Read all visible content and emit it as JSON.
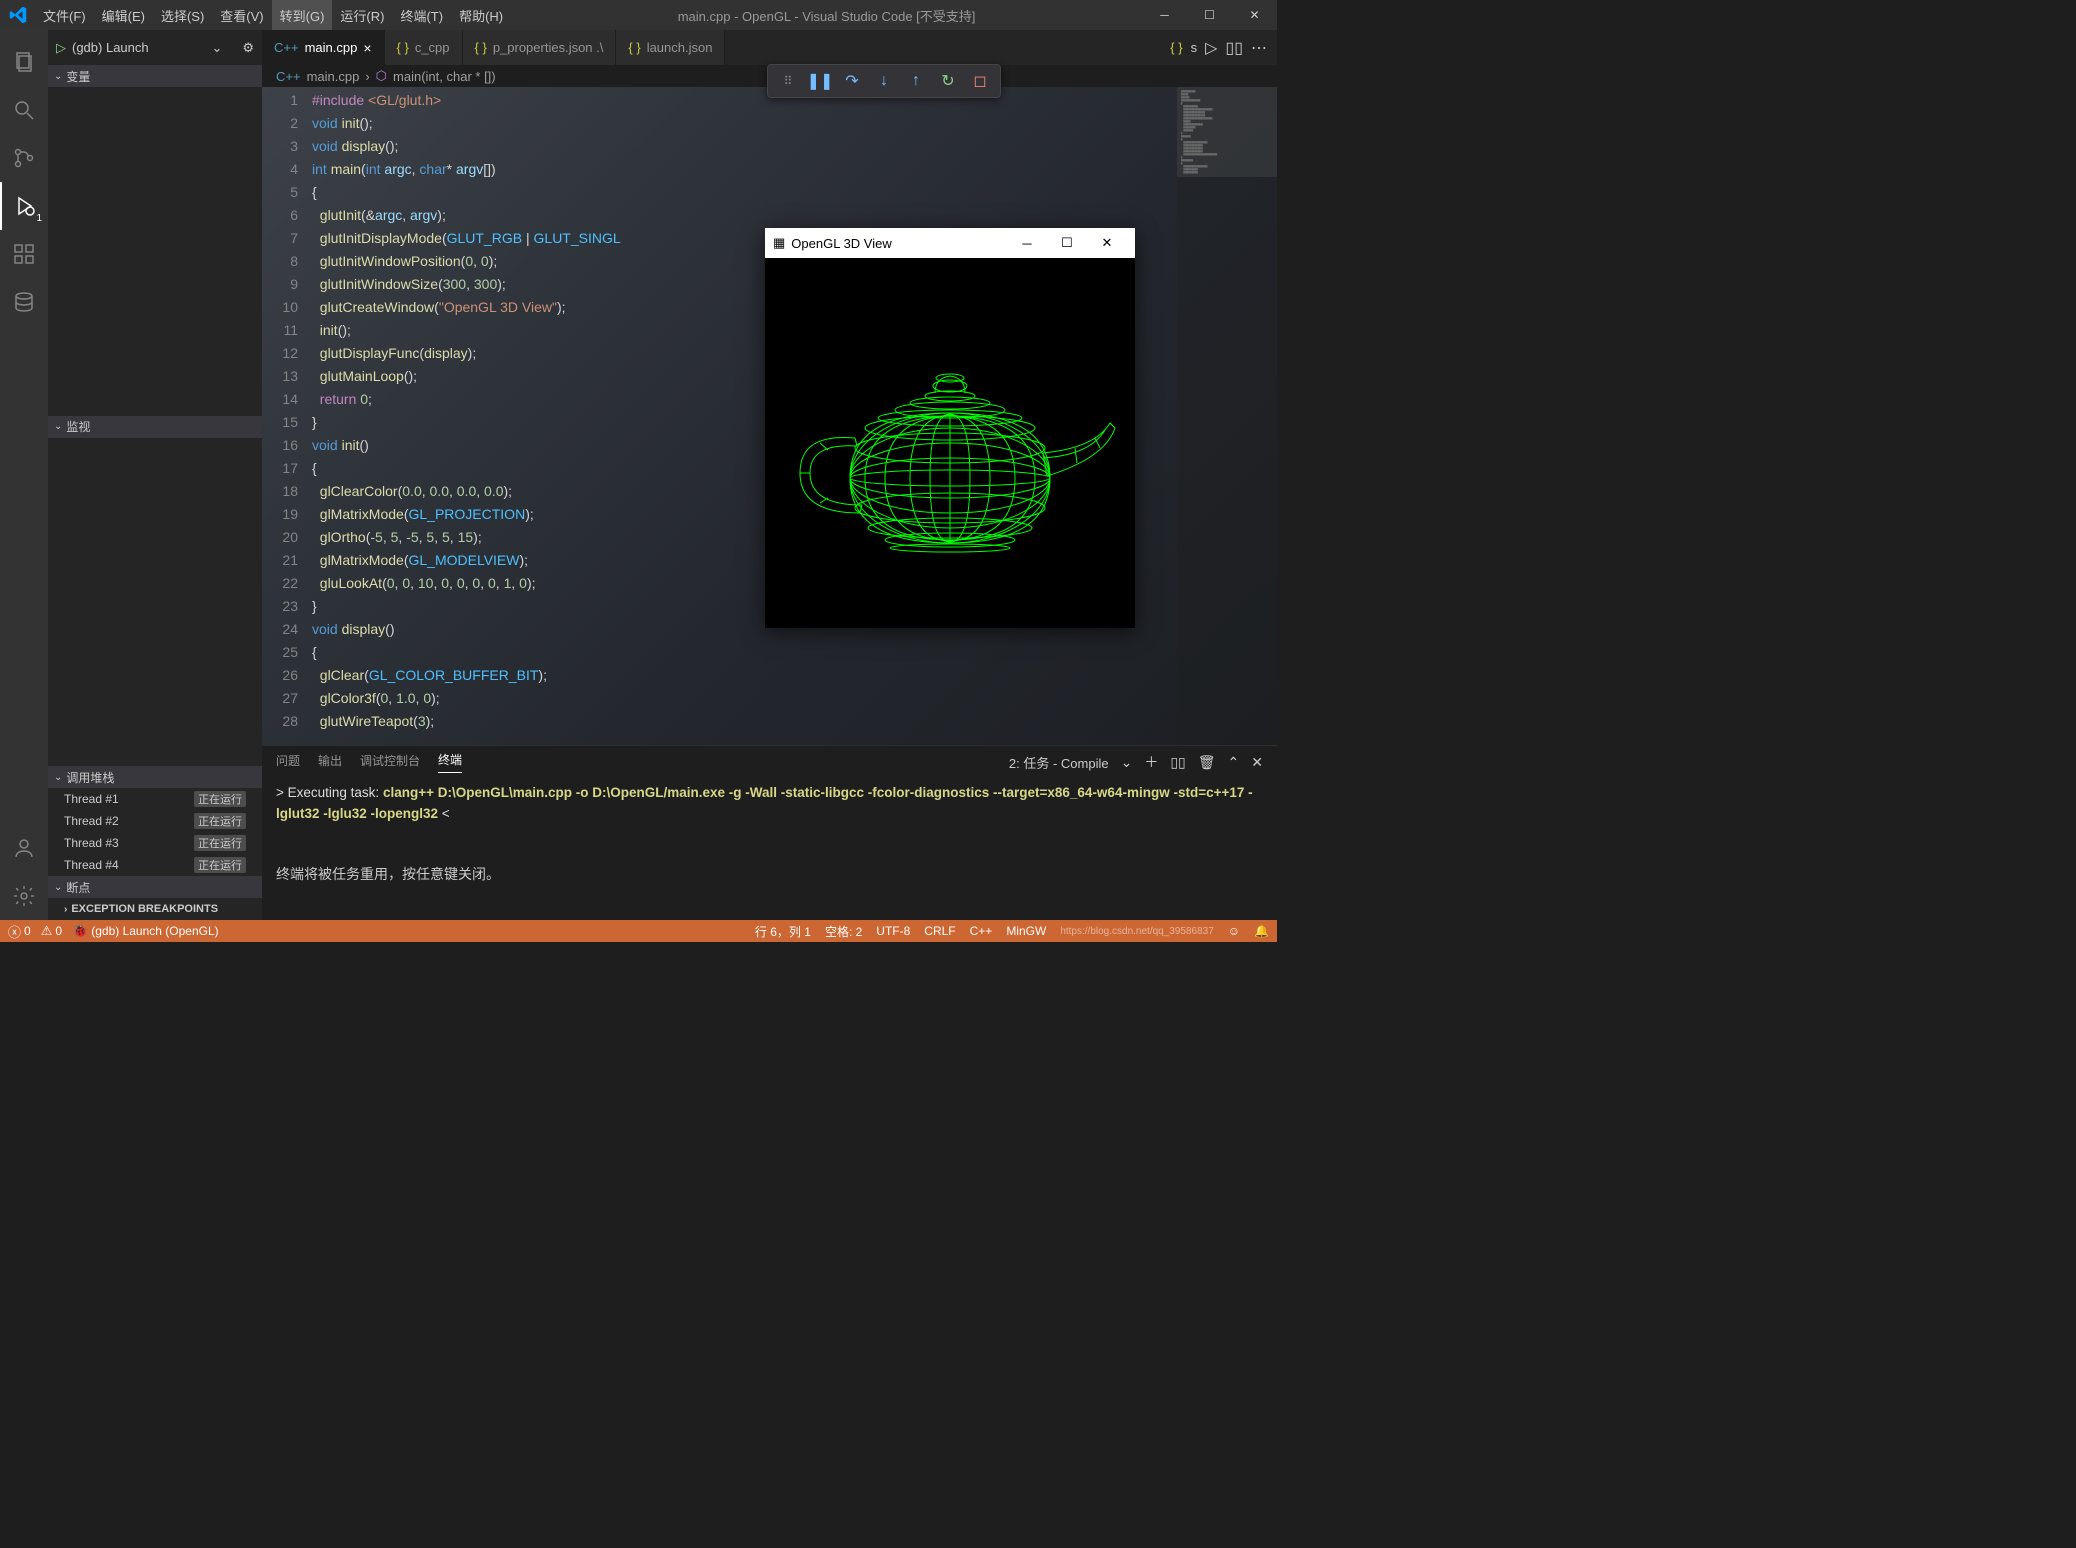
{
  "titlebar": {
    "menus": [
      "文件(F)",
      "编辑(E)",
      "选择(S)",
      "查看(V)",
      "转到(G)",
      "运行(R)",
      "终端(T)",
      "帮助(H)"
    ],
    "active_menu_index": 4,
    "title": "main.cpp - OpenGL - Visual Studio Code [不受支持]"
  },
  "activity": {
    "icons": [
      "files",
      "search",
      "source-control",
      "run-debug",
      "extensions",
      "database"
    ],
    "active_index": 3,
    "debug_badge": "1"
  },
  "sidebar": {
    "launch_label": "(gdb) Launch",
    "sections": {
      "variables": "变量",
      "watch": "监视",
      "callstack": "调用堆栈",
      "breakpoints": "断点",
      "exception_bp": "EXCEPTION BREAKPOINTS"
    },
    "running_tag": "正在运行",
    "threads": [
      "Thread #1",
      "Thread #2",
      "Thread #3",
      "Thread #4"
    ]
  },
  "tabs": [
    {
      "icon": "cpp",
      "label": "main.cpp",
      "active": true,
      "close": true
    },
    {
      "icon": "json",
      "label": "c_cpp",
      "active": false
    },
    {
      "icon": "json",
      "label": "p_properties.json .\\",
      "active": false
    },
    {
      "icon": "json",
      "label": "launch.json",
      "active": false
    }
  ],
  "tabs_right_s_label": "s",
  "breadcrumb": {
    "file_icon": "cpp",
    "file": "main.cpp",
    "sym_icon": "func",
    "symbol": "main(int, char * [])",
    "sep": "›"
  },
  "code": {
    "start_line": 1,
    "lines_html": [
      "<span class='tok-pp'>#include</span> <span class='tok-str'>&lt;GL/glut.h&gt;</span>",
      "<span class='tok-kw'>void</span> <span class='tok-fn'>init</span><span class='tok-op'>();</span>",
      "<span class='tok-kw'>void</span> <span class='tok-fn'>display</span><span class='tok-op'>();</span>",
      "<span class='tok-kw'>int</span> <span class='tok-fn'>main</span><span class='tok-op'>(</span><span class='tok-kw'>int</span> <span class='tok-param'>argc</span><span class='tok-op'>, </span><span class='tok-kw'>char</span><span class='tok-op'>* </span><span class='tok-param'>argv</span><span class='tok-op'>[])</span>",
      "<span class='tok-op'>{</span>",
      "  <span class='tok-fn'>glutInit</span><span class='tok-op'>(&amp;</span><span class='tok-param'>argc</span><span class='tok-op'>, </span><span class='tok-param'>argv</span><span class='tok-op'>);</span>",
      "  <span class='tok-fn'>glutInitDisplayMode</span><span class='tok-op'>(</span><span class='tok-const'>GLUT_RGB</span> <span class='tok-op'>|</span> <span class='tok-const'>GLUT_SINGL</span>",
      "  <span class='tok-fn'>glutInitWindowPosition</span><span class='tok-op'>(</span><span class='tok-num'>0</span><span class='tok-op'>, </span><span class='tok-num'>0</span><span class='tok-op'>);</span>",
      "  <span class='tok-fn'>glutInitWindowSize</span><span class='tok-op'>(</span><span class='tok-num'>300</span><span class='tok-op'>, </span><span class='tok-num'>300</span><span class='tok-op'>);</span>",
      "  <span class='tok-fn'>glutCreateWindow</span><span class='tok-op'>(</span><span class='tok-str'>\"OpenGL 3D View\"</span><span class='tok-op'>);</span>",
      "  <span class='tok-fn'>init</span><span class='tok-op'>();</span>",
      "  <span class='tok-fn'>glutDisplayFunc</span><span class='tok-op'>(</span><span class='tok-fn'>display</span><span class='tok-op'>);</span>",
      "  <span class='tok-fn'>glutMainLoop</span><span class='tok-op'>();</span>",
      "  <span class='tok-pp'>return</span> <span class='tok-num'>0</span><span class='tok-op'>;</span>",
      "<span class='tok-op'>}</span>",
      "<span class='tok-kw'>void</span> <span class='tok-fn'>init</span><span class='tok-op'>()</span>",
      "<span class='tok-op'>{</span>",
      "  <span class='tok-fn'>glClearColor</span><span class='tok-op'>(</span><span class='tok-num'>0.0</span><span class='tok-op'>, </span><span class='tok-num'>0.0</span><span class='tok-op'>, </span><span class='tok-num'>0.0</span><span class='tok-op'>, </span><span class='tok-num'>0.0</span><span class='tok-op'>);</span>",
      "  <span class='tok-fn'>glMatrixMode</span><span class='tok-op'>(</span><span class='tok-const'>GL_PROJECTION</span><span class='tok-op'>);</span>",
      "  <span class='tok-fn'>glOrtho</span><span class='tok-op'>(</span><span class='tok-num'>-5</span><span class='tok-op'>, </span><span class='tok-num'>5</span><span class='tok-op'>, </span><span class='tok-num'>-5</span><span class='tok-op'>, </span><span class='tok-num'>5</span><span class='tok-op'>, </span><span class='tok-num'>5</span><span class='tok-op'>, </span><span class='tok-num'>15</span><span class='tok-op'>);</span>",
      "  <span class='tok-fn'>glMatrixMode</span><span class='tok-op'>(</span><span class='tok-const'>GL_MODELVIEW</span><span class='tok-op'>);</span>",
      "  <span class='tok-fn'>gluLookAt</span><span class='tok-op'>(</span><span class='tok-num'>0</span><span class='tok-op'>, </span><span class='tok-num'>0</span><span class='tok-op'>, </span><span class='tok-num'>10</span><span class='tok-op'>, </span><span class='tok-num'>0</span><span class='tok-op'>, </span><span class='tok-num'>0</span><span class='tok-op'>, </span><span class='tok-num'>0</span><span class='tok-op'>, </span><span class='tok-num'>0</span><span class='tok-op'>, </span><span class='tok-num'>1</span><span class='tok-op'>, </span><span class='tok-num'>0</span><span class='tok-op'>);</span>",
      "<span class='tok-op'>}</span>",
      "<span class='tok-kw'>void</span> <span class='tok-fn'>display</span><span class='tok-op'>()</span>",
      "<span class='tok-op'>{</span>",
      "  <span class='tok-fn'>glClear</span><span class='tok-op'>(</span><span class='tok-const'>GL_COLOR_BUFFER_BIT</span><span class='tok-op'>);</span>",
      "  <span class='tok-fn'>glColor3f</span><span class='tok-op'>(</span><span class='tok-num'>0</span><span class='tok-op'>, </span><span class='tok-num'>1.0</span><span class='tok-op'>, </span><span class='tok-num'>0</span><span class='tok-op'>);</span>",
      "  <span class='tok-fn'>glutWireTeapot</span><span class='tok-op'>(</span><span class='tok-num'>3</span><span class='tok-op'>);</span>"
    ]
  },
  "gl_window": {
    "title": "OpenGL 3D View"
  },
  "panel": {
    "tabs": [
      "问题",
      "输出",
      "调试控制台",
      "终端"
    ],
    "active_tab_index": 3,
    "task_selector": "2: 任务 - Compile",
    "term_line1_prefix": "> Executing task: ",
    "term_line1_cmd": "clang++ D:\\OpenGL\\main.cpp -o D:\\OpenGL/main.exe -g -Wall -static-libgcc -fcolor-diagnostics --target=x86_64-w64-mingw -std=c++17 -lglut32 -lglu32 -lopengl32 ",
    "term_line1_suffix": "<",
    "term_msg": "终端将被任务重用，按任意键关闭。"
  },
  "statusbar": {
    "errors": "0",
    "warnings": "0",
    "launch": "(gdb) Launch (OpenGL)",
    "pos": "行 6，列 1",
    "spaces": "空格: 2",
    "encoding": "UTF-8",
    "eol": "CRLF",
    "lang": "C++",
    "compiler": "MinGW",
    "watermark": "https://blog.csdn.net/qq_39586837"
  }
}
